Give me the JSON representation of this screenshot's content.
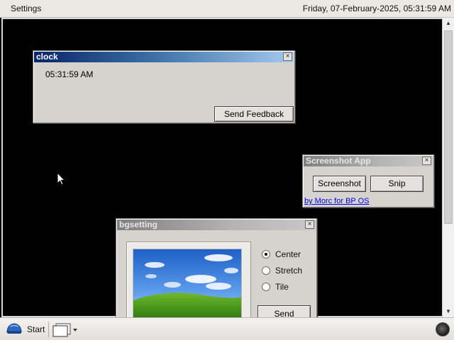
{
  "topbar": {
    "app_title": "Settings",
    "datetime": "Friday, 07-February-2025, 05:31:59 AM"
  },
  "clock_window": {
    "title": "clock",
    "close": "×",
    "time": "05:31:59 AM",
    "feedback_button": "Send Feedback"
  },
  "screenshot_window": {
    "title": "Screenshot App",
    "close": "×",
    "screenshot_button": "Screenshot",
    "snip_button": "Snip",
    "credit_link": "by Morc for BP OS"
  },
  "bgsetting_window": {
    "title": "bgsetting",
    "close": "×",
    "options": [
      {
        "label": "Center",
        "checked": true
      },
      {
        "label": "Stretch",
        "checked": false
      },
      {
        "label": "Tile",
        "checked": false
      }
    ],
    "send_button": "Send"
  },
  "taskbar": {
    "start_label": "Start",
    "start_icon": "bp-os-logo-icon",
    "window_list_icon": "window-list-icon",
    "tray_icon": "tray-status-icon"
  },
  "colors": {
    "desktop": "#000000",
    "active_title": "#0a246a",
    "window_face": "#d6d3ce",
    "link": "#0000ee"
  }
}
